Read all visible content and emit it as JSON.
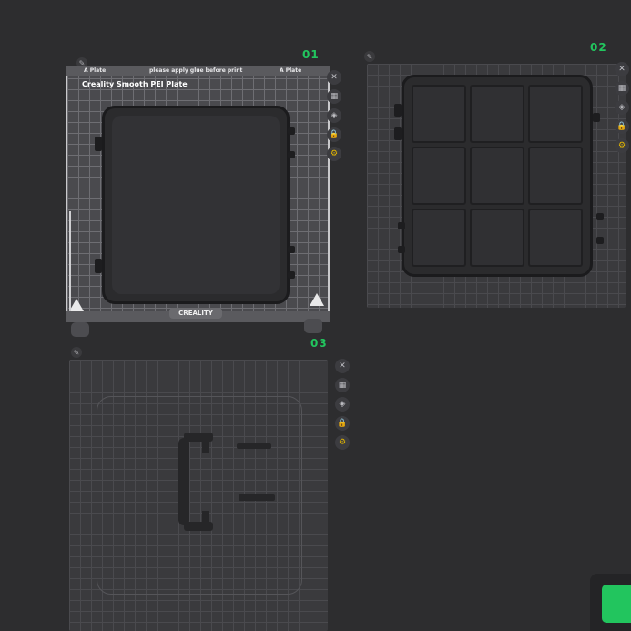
{
  "plates": [
    {
      "number": "01",
      "header_left": "A Plate",
      "header_center": "please apply glue before print",
      "header_right": "A Plate",
      "title": "Creality Smooth PEI Plate",
      "brand": "CREALITY"
    },
    {
      "number": "02"
    },
    {
      "number": "03"
    }
  ],
  "plate_icons": [
    "close-icon",
    "arrange-icon",
    "orient-icon",
    "lock-icon",
    "settings-icon"
  ],
  "icon_glyphs": {
    "close": "✕",
    "arrange": "▦",
    "orient": "◈",
    "lock": "🔒",
    "settings": "⚙",
    "edit": "✎"
  },
  "colors": {
    "accent": "#22c55e",
    "gold": "#e5b800",
    "background": "#2d2d2f"
  }
}
